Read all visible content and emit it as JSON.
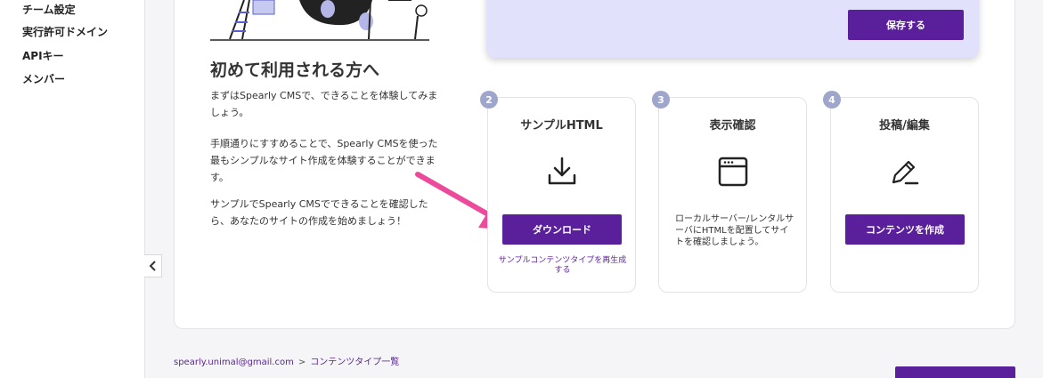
{
  "sidebar": {
    "items": [
      {
        "label": "チーム設定"
      },
      {
        "label": "実行許可ドメイン"
      },
      {
        "label": "APIキー"
      },
      {
        "label": "メンバー"
      }
    ]
  },
  "intro": {
    "title": "初めて利用される方へ",
    "paragraphs": [
      "まずはSpearly CMSで、できることを体験してみましょう。",
      "手順通りにすすめることで、Spearly CMSを使った最もシンプルなサイト作成を体験することができます。",
      "サンプルでSpearly CMSでできることを確認したら、あなたのサイトの作成を始めましょう！"
    ]
  },
  "save_panel": {
    "save_label": "保存する"
  },
  "steps": [
    {
      "number": "2",
      "title": "サンプルHTML",
      "icon": "download-icon",
      "button_label": "ダウンロード",
      "link_label": "サンプルコンテンツタイプを再生成する"
    },
    {
      "number": "3",
      "title": "表示確認",
      "icon": "browser-window-icon",
      "description": "ローカルサーバー/レンタルサーバにHTMLを配置してサイトを確認しましょう。"
    },
    {
      "number": "4",
      "title": "投稿/編集",
      "icon": "pencil-edit-icon",
      "button_label": "コンテンツを作成"
    }
  ],
  "breadcrumb": {
    "email": "spearly.unimal@gmail.com",
    "separator": ">",
    "current": "コンテンツタイプ一覧"
  },
  "colors": {
    "accent": "#5a1f9a",
    "panel": "#e1e1fb",
    "step_badge": "#9ea6cc",
    "arrow": "#ec4b9b"
  }
}
